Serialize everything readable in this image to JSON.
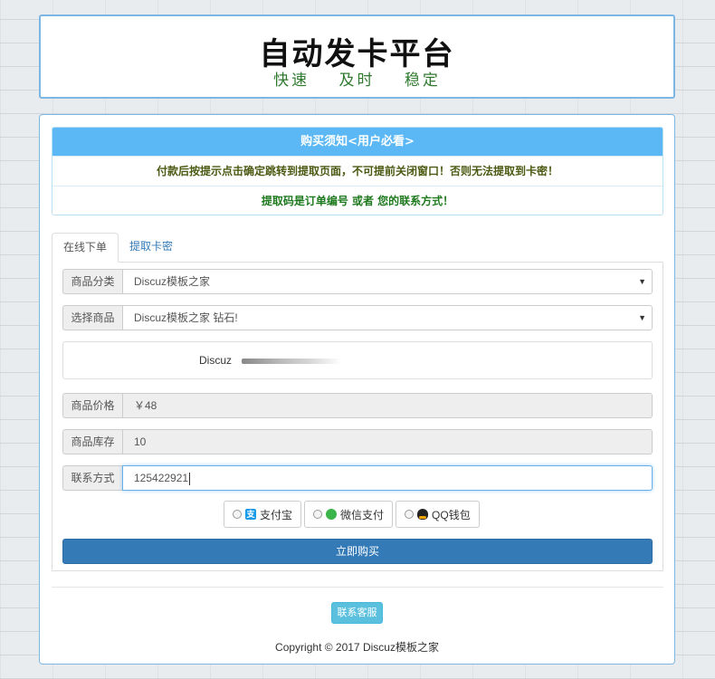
{
  "header": {
    "title": "自动发卡平台",
    "slogan": "快速 及时 稳定"
  },
  "notice": {
    "heading": "购买须知<用户必看>",
    "line1": "付款后按提示点击确定跳转到提取页面，不可提前关闭窗口！否则无法提取到卡密！",
    "line2": "提取码是订单编号 或者 您的联系方式！"
  },
  "tabs": [
    {
      "label": "在线下单",
      "active": true
    },
    {
      "label": "提取卡密",
      "active": false
    }
  ],
  "form": {
    "category": {
      "label": "商品分类",
      "value": "Discuz模板之家"
    },
    "product": {
      "label": "选择商品",
      "value": "Discuz模板之家 钻石!"
    },
    "description": {
      "text": "Discuz"
    },
    "price": {
      "label": "商品价格",
      "value": "￥48"
    },
    "stock": {
      "label": "商品库存",
      "value": "10"
    },
    "contact": {
      "label": "联系方式",
      "value": "125422921"
    }
  },
  "payment": {
    "options": [
      {
        "label": "支付宝",
        "icon": "alipay-icon"
      },
      {
        "label": "微信支付",
        "icon": "wechat-icon"
      },
      {
        "label": "QQ钱包",
        "icon": "qq-icon"
      }
    ]
  },
  "buttons": {
    "buy": "立即购买",
    "service": "联系客服"
  },
  "footer": {
    "copyright": "Copyright © 2017 Discuz模板之家"
  },
  "colors": {
    "notice_header": "#5bb8f5",
    "primary": "#337ab7",
    "info": "#5bc0de",
    "slogan": "#2f7a2f"
  }
}
